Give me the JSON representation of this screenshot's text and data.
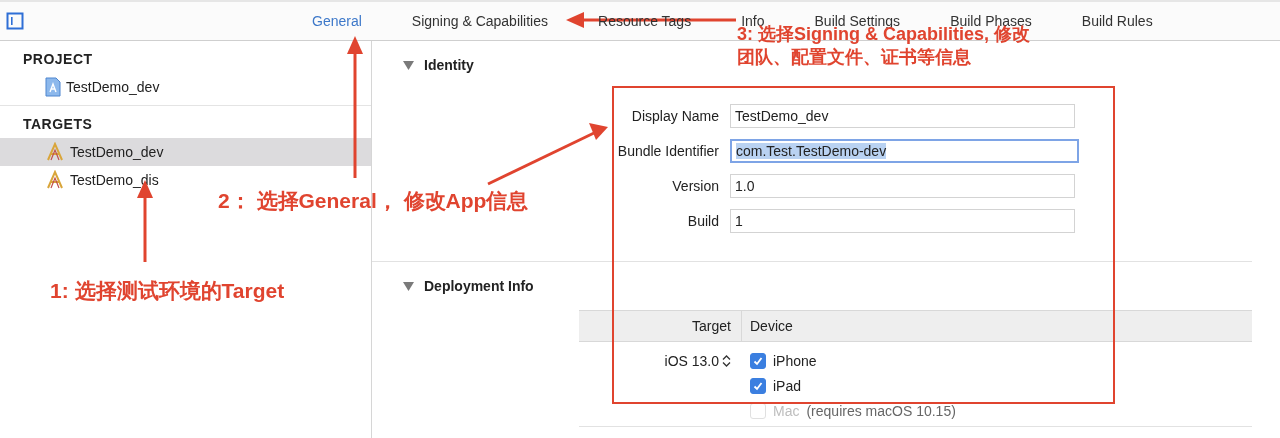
{
  "tabs": [
    {
      "label": "General",
      "selected": true
    },
    {
      "label": "Signing & Capabilities",
      "selected": false
    },
    {
      "label": "Resource Tags",
      "selected": false
    },
    {
      "label": "Info",
      "selected": false
    },
    {
      "label": "Build Settings",
      "selected": false
    },
    {
      "label": "Build Phases",
      "selected": false
    },
    {
      "label": "Build Rules",
      "selected": false
    }
  ],
  "sidebar": {
    "sections": [
      {
        "title": "PROJECT",
        "items": [
          {
            "label": "TestDemo_dev",
            "kind": "project",
            "selected": false
          }
        ]
      },
      {
        "title": "TARGETS",
        "items": [
          {
            "label": "TestDemo_dev",
            "kind": "target",
            "selected": true
          },
          {
            "label": "TestDemo_dis",
            "kind": "target",
            "selected": false
          }
        ]
      }
    ]
  },
  "identity": {
    "title": "Identity",
    "expanded": true,
    "fields": [
      {
        "label": "Display Name",
        "value": "TestDemo_dev",
        "focused": false
      },
      {
        "label": "Bundle Identifier",
        "value": "com.Test.TestDemo-dev",
        "focused": true
      },
      {
        "label": "Version",
        "value": "1.0",
        "focused": false
      },
      {
        "label": "Build",
        "value": "1",
        "focused": false
      }
    ]
  },
  "deployment": {
    "title": "Deployment Info",
    "expanded": true,
    "columns": [
      "Target",
      "Device"
    ],
    "target_value": "iOS 13.0",
    "devices": [
      {
        "label": "iPhone",
        "checked": true,
        "disabled": false
      },
      {
        "label": "iPad",
        "checked": true,
        "disabled": false
      },
      {
        "label": "Mac",
        "note": "(requires macOS 10.15)",
        "checked": false,
        "disabled": true
      }
    ]
  },
  "annotations": [
    {
      "lines": [
        "1: 选择测试环境的Target"
      ]
    },
    {
      "lines": [
        "2：  选择General，  修改App信息"
      ]
    },
    {
      "lines": [
        "3: 选择Signing & Capabilities, 修改"
      ]
    },
    {
      "lines": [
        "团队、配置文件、证书等信息"
      ]
    }
  ]
}
